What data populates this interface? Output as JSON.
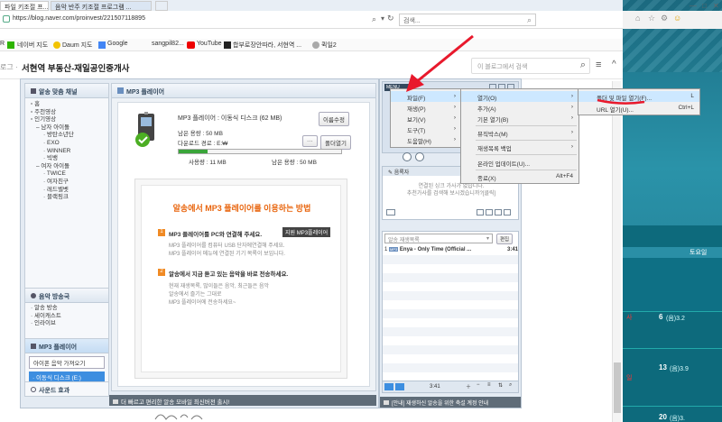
{
  "browser": {
    "tabs": [
      "파일 키조절 프...",
      "음악 반주 키조절 프로그램 ...",
      ""
    ],
    "url": "https://blog.naver.com/proinvest/221507118895",
    "search_label": "검색...",
    "bookmarks": [
      "R",
      "네이버 지도",
      "Daum 지도",
      "Google",
      "sangpil82...",
      "YouTube",
      "합부로장안따라, 서현역 ...",
      "퀵일2"
    ]
  },
  "blog": {
    "prefix": "로그 ·",
    "title": "서현역 부동산-재일공인중개사",
    "search_placeholder": "이 블로그에서 검색"
  },
  "sidebar": {
    "section1_title": "알송 맞춤 채널",
    "section1_items": [
      "홈",
      "주천영상",
      "인기영상",
      "남자 아이돌",
      "방탄소년단",
      "EXO",
      "WINNER",
      "빅뱅",
      "여자 아이돌",
      "TWICE",
      "여자친구",
      "레드벨벳",
      "블랙핑크"
    ],
    "section2_title": "음악 방송국",
    "section2_items": [
      "알송 방송",
      "세이캐스트",
      "인라이브"
    ],
    "section3_title": "MP3 플레이어",
    "section3_items": [
      "아이폰 음악 가져오기",
      "이동식 디스크 (E:)"
    ],
    "section4_title": "사운드 효과"
  },
  "mp3": {
    "title": "MP3 플레이어",
    "device_label": "MP3 플레이어 : 이동식 디스크 (62 MB)",
    "rename_btn": "이름수정",
    "remaining_label": "남은 용량 : 50 MB",
    "download_path": "다운로드 경로 : E:₩",
    "more_btn": "···",
    "open_folder_btn": "폴더열기",
    "used": "사용량 : 11 MB",
    "remaining": "남은 용량 : 50 MB",
    "usage_fraction": 0.18,
    "guide_title": "알송에서 MP3 플레이어를 이용하는 방법",
    "step1_title": "MP3 플레이어를 PC와 연결해 주세요.",
    "step1_badge": "지원 MP3플레이어",
    "step1_desc": [
      "MP3 플레이어를 컴퓨터 USB 단자에연결해 주세요.",
      "MP3 플레이어 메뉴에 연결된 기기 목록이 보입니다."
    ],
    "step2_title": "알송에서 지금 듣고 있는 음악을 바로 전송하세요.",
    "step2_desc": [
      "현재 재생목록, 많이들은 음악, 최근들은 음악",
      "알송에서 즐기는 그대로",
      "MP3 플레이어에 전송하세요~"
    ]
  },
  "player": {
    "logo": "MENU",
    "lyrics_title": "음록자",
    "lyrics_text": [
      "연결된 싱크 가사가 없습니다.",
      "추천가사를 검색해 보시겠습니까?[클릭]"
    ],
    "playlist_select": "알송 재생목록",
    "edit_btn": "편집",
    "track_index": "1",
    "track_title": "Enya - Only Time (Official ...",
    "track_time": "3:41",
    "footer_time": "3:41"
  },
  "menu_main": [
    "파일(F)",
    "재생(P)",
    "보기(V)",
    "도구(T)",
    "도움말(H)"
  ],
  "menu_file": [
    {
      "label": "열기(O)",
      "shortcut": ""
    },
    {
      "label": "추가(A)",
      "shortcut": ""
    },
    {
      "label": "기본 열기(B)",
      "shortcut": ""
    },
    {
      "label": "뮤직박스(M)",
      "shortcut": ""
    },
    {
      "label": "재생목록 백업",
      "shortcut": ""
    },
    {
      "label": "온라인 업데이트(U)...",
      "shortcut": ""
    },
    {
      "label": "종료(X)",
      "shortcut": "Alt+F4"
    }
  ],
  "menu_open": [
    {
      "label": "폴더 및 파일 열기(F)...",
      "shortcut": "L"
    },
    {
      "label": "URL 열기(U)...",
      "shortcut": "Ctrl+L"
    }
  ],
  "status_left": "더 빠르고 편리한 알송 모바일 최신버전 출시!",
  "status_right": "[안내] 재생하신 알송을 위한 축설 계정 안내",
  "desktop": {
    "weekday": "토요일",
    "days": [
      {
        "date": "6",
        "text": "(음)3.2"
      },
      {
        "date": "13",
        "text": "(음)3.9"
      },
      {
        "date": "20",
        "text": "(음)3."
      }
    ],
    "side_labels": [
      "사",
      "일"
    ]
  },
  "colors": {
    "accent": "#e8640c",
    "menu_highlight": "#cde8ff",
    "annotation": "#e8192c"
  }
}
